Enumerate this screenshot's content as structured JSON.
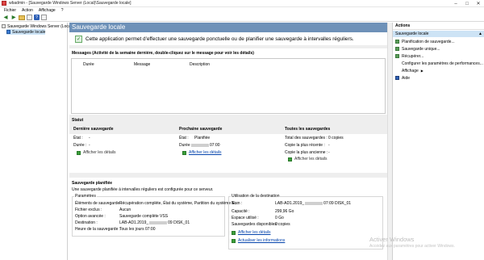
{
  "window": {
    "title": "wbadmin - [Sauvegarde Windows Server (Local)\\Sauvegarde locale]",
    "controls": [
      "–",
      "□",
      "✕"
    ]
  },
  "menu": [
    "Fichier",
    "Action",
    "Affichage",
    "?"
  ],
  "tree": {
    "root": "Sauvegarde Windows Server (Local)",
    "child": "Sauvegarde locale"
  },
  "main": {
    "header": "Sauvegarde locale",
    "intro": "Cette application permet d'effectuer une sauvegarde ponctuelle ou de planifier une sauvegarde à intervalles réguliers.",
    "messages": {
      "title": "Messages (Activité de la semaine dernière, double-cliquez sur le message pour voir les détails)",
      "columns": [
        "Durée",
        "Message",
        "Description"
      ]
    },
    "statut": {
      "title": "Statut",
      "derniere": {
        "title": "Dernière sauvegarde",
        "etat_label": "État :",
        "etat_value": "-",
        "duree_label": "Durée :",
        "duree_value": "-",
        "link": "Afficher les détails"
      },
      "prochaine": {
        "title": "Prochaine sauvegarde",
        "etat_label": "État :",
        "etat_value": "Planifiée",
        "duree_label": "Durée :",
        "duree_value": "07:00",
        "link": "Afficher les détails"
      },
      "toutes": {
        "title": "Toutes les sauvegardes",
        "total_label": "Total des sauvegardes :",
        "total_value": "0 copies",
        "recente_label": "Copie la plus récente :",
        "recente_value": "-",
        "ancienne_label": "Copie la plus ancienne :",
        "ancienne_value": "-",
        "link": "Afficher les détails"
      }
    },
    "planifiee": {
      "title": "Sauvegarde planifiée",
      "intro": "Une sauvegarde planifiée à intervalles réguliers est configurée pour ce serveur.",
      "parametres": {
        "group": "Paramètres",
        "rows": [
          {
            "label": "Éléments de sauvegarde :",
            "value": "Récupération complète, État du système, Partition du système E..."
          },
          {
            "label": "Fichier exclus :",
            "value": "Aucun"
          },
          {
            "label": "Option avancée :",
            "value": "Sauvegarde complète VSS"
          },
          {
            "label": "Destination :",
            "value_prefix": "LAB-AD1.2019_",
            "value_suffix": "09 DISK_01"
          },
          {
            "label": "Heure de la sauvegarde :",
            "value": "Tous les jours 07:00"
          }
        ]
      },
      "destination": {
        "group": "Utilisation de la destination",
        "rows": [
          {
            "label": "Nom :",
            "value_prefix": "LAB-AD1.2019_",
            "value_suffix": "07:09 DISK_01"
          },
          {
            "label": "Capacité :",
            "value": "299,96 Go"
          },
          {
            "label": "Espace utilisé :",
            "value": "0 Go"
          },
          {
            "label": "Sauvegardes disponibles :",
            "value": "0 copies"
          }
        ],
        "link1": "Afficher les détails",
        "link2": "Actualiser les informations"
      }
    }
  },
  "actions": {
    "title": "Actions",
    "subheader": "Sauvegarde locale",
    "items": [
      "Planification de sauvegarde...",
      "Sauvegarde unique...",
      "Récupérer...",
      "Configurer les paramètres de performances...",
      "Affichage",
      "Aide"
    ]
  },
  "watermark": {
    "line1": "Activer Windows",
    "line2": "Accédez aux paramètres pour activer Windows."
  }
}
